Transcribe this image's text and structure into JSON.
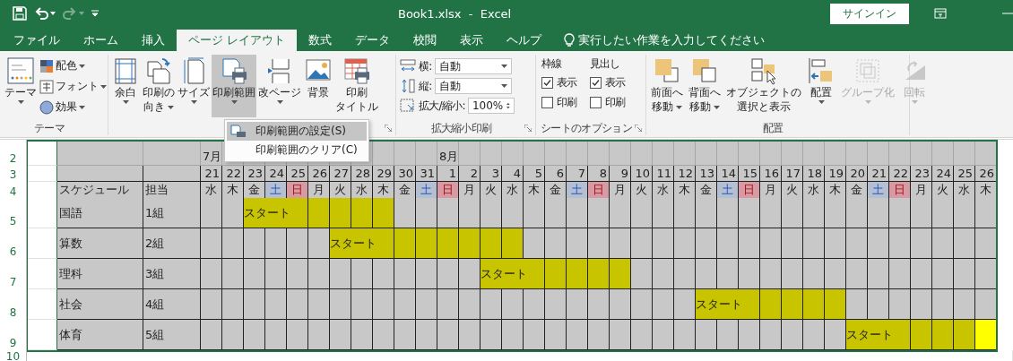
{
  "title_bar": {
    "title": "Book1.xlsx  -  Excel",
    "redo_disabled": true,
    "sign_in": "サインイン"
  },
  "tabs": [
    {
      "label": "ファイル",
      "selected": false
    },
    {
      "label": "ホーム",
      "selected": false
    },
    {
      "label": "挿入",
      "selected": false
    },
    {
      "label": "ページ レイアウト",
      "selected": true
    },
    {
      "label": "数式",
      "selected": false
    },
    {
      "label": "データ",
      "selected": false
    },
    {
      "label": "校閲",
      "selected": false
    },
    {
      "label": "表示",
      "selected": false
    },
    {
      "label": "ヘルプ",
      "selected": false
    }
  ],
  "tell_me": "実行したい作業を入力してください",
  "ribbon": {
    "theme": {
      "label": "テーマ",
      "button": {
        "lines": [
          "テーマ"
        ]
      },
      "options": [
        {
          "label": "配色"
        },
        {
          "label": "フォント"
        },
        {
          "label": "効果"
        }
      ]
    },
    "page_setup": {
      "buttons": [
        {
          "lines": [
            "余白"
          ],
          "has_menu": true,
          "pressed": false
        },
        {
          "lines": [
            "印刷の",
            "向き"
          ],
          "has_menu": true,
          "pressed": false
        },
        {
          "lines": [
            "サイズ"
          ],
          "has_menu": true,
          "pressed": false
        },
        {
          "lines": [
            "印刷範囲"
          ],
          "has_menu": true,
          "pressed": true
        },
        {
          "lines": [
            "改ページ"
          ],
          "has_menu": true,
          "pressed": false
        },
        {
          "lines": [
            "背景"
          ],
          "has_menu": false,
          "pressed": false
        },
        {
          "lines": [
            "印刷",
            "タイトル"
          ],
          "has_menu": false,
          "pressed": false
        }
      ]
    },
    "scale": {
      "label": "拡大縮小印刷",
      "fields": [
        {
          "label": "横:",
          "value": "自動",
          "kind": "dropdown"
        },
        {
          "label": "縦:",
          "value": "自動",
          "kind": "dropdown"
        },
        {
          "label": "拡大/縮小:",
          "value": "100%",
          "kind": "spinner"
        }
      ]
    },
    "sheet_options": {
      "label": "シートのオプション",
      "columns": [
        {
          "heading": "枠線",
          "options": [
            {
              "label": "表示",
              "checked": true
            },
            {
              "label": "印刷",
              "checked": false
            }
          ]
        },
        {
          "heading": "見出し",
          "options": [
            {
              "label": "表示",
              "checked": true
            },
            {
              "label": "印刷",
              "checked": false
            }
          ]
        }
      ]
    },
    "arrange": {
      "label": "配置",
      "buttons": [
        {
          "lines": [
            "前面へ",
            "移動"
          ],
          "has_menu": true,
          "disabled": false
        },
        {
          "lines": [
            "背面へ",
            "移動"
          ],
          "has_menu": true,
          "disabled": false
        },
        {
          "lines": [
            "オブジェクトの",
            "選択と表示"
          ],
          "has_menu": false,
          "disabled": false
        },
        {
          "lines": [
            "配置"
          ],
          "has_menu": true,
          "disabled": false
        },
        {
          "lines": [
            "グループ化"
          ],
          "has_menu": true,
          "disabled": true
        },
        {
          "lines": [
            "回転"
          ],
          "has_menu": true,
          "disabled": true
        }
      ]
    }
  },
  "print_area_menu": {
    "items": [
      {
        "label": "印刷範囲の設定(S)",
        "selected": true
      },
      {
        "label": "印刷範囲のクリア(C)",
        "selected": false
      }
    ]
  },
  "sheet": {
    "row_numbers": [
      "2",
      "3",
      "4",
      "5",
      "6",
      "7",
      "8",
      "9",
      "10"
    ],
    "headers": [
      "スケジュール",
      "担当"
    ],
    "days": [
      {
        "month": "7月",
        "date": "21",
        "weekday": "水",
        "kind": "weekday"
      },
      {
        "date": "22",
        "weekday": "木",
        "kind": "weekday"
      },
      {
        "date": "23",
        "weekday": "金",
        "kind": "weekday"
      },
      {
        "date": "24",
        "weekday": "土",
        "kind": "saturday"
      },
      {
        "date": "25",
        "weekday": "日",
        "kind": "sunday"
      },
      {
        "date": "26",
        "weekday": "月",
        "kind": "weekday"
      },
      {
        "date": "27",
        "weekday": "火",
        "kind": "weekday"
      },
      {
        "date": "28",
        "weekday": "水",
        "kind": "weekday"
      },
      {
        "date": "29",
        "weekday": "木",
        "kind": "weekday"
      },
      {
        "date": "30",
        "weekday": "金",
        "kind": "weekday"
      },
      {
        "date": "31",
        "weekday": "土",
        "kind": "saturday"
      },
      {
        "month": "8月",
        "date": "1",
        "weekday": "日",
        "kind": "sunday"
      },
      {
        "date": "2",
        "weekday": "月",
        "kind": "weekday"
      },
      {
        "date": "3",
        "weekday": "火",
        "kind": "weekday"
      },
      {
        "date": "4",
        "weekday": "水",
        "kind": "weekday"
      },
      {
        "date": "5",
        "weekday": "木",
        "kind": "weekday"
      },
      {
        "date": "6",
        "weekday": "金",
        "kind": "weekday"
      },
      {
        "date": "7",
        "weekday": "土",
        "kind": "saturday"
      },
      {
        "date": "8",
        "weekday": "日",
        "kind": "sunday"
      },
      {
        "date": "9",
        "weekday": "月",
        "kind": "weekday"
      },
      {
        "date": "10",
        "weekday": "火",
        "kind": "weekday"
      },
      {
        "date": "11",
        "weekday": "水",
        "kind": "weekday"
      },
      {
        "date": "12",
        "weekday": "木",
        "kind": "weekday"
      },
      {
        "date": "13",
        "weekday": "金",
        "kind": "weekday"
      },
      {
        "date": "14",
        "weekday": "土",
        "kind": "saturday"
      },
      {
        "date": "15",
        "weekday": "日",
        "kind": "sunday"
      },
      {
        "date": "16",
        "weekday": "月",
        "kind": "weekday"
      },
      {
        "date": "17",
        "weekday": "火",
        "kind": "weekday"
      },
      {
        "date": "18",
        "weekday": "水",
        "kind": "weekday"
      },
      {
        "date": "19",
        "weekday": "木",
        "kind": "weekday"
      },
      {
        "date": "20",
        "weekday": "金",
        "kind": "weekday"
      },
      {
        "date": "21",
        "weekday": "土",
        "kind": "saturday"
      },
      {
        "date": "22",
        "weekday": "日",
        "kind": "sunday"
      },
      {
        "date": "23",
        "weekday": "月",
        "kind": "weekday"
      },
      {
        "date": "24",
        "weekday": "火",
        "kind": "weekday"
      },
      {
        "date": "25",
        "weekday": "水",
        "kind": "weekday"
      },
      {
        "date": "26",
        "weekday": "木",
        "kind": "weekday"
      }
    ],
    "rows": [
      {
        "subject": "国語",
        "group": "1組",
        "cells": [
          {
            "filled": false,
            "highlighted": false
          },
          {
            "filled": false,
            "highlighted": false
          },
          {
            "filled": true,
            "highlighted": false,
            "text": "スタート"
          },
          {
            "filled": true,
            "highlighted": false
          },
          {
            "filled": true,
            "highlighted": false
          },
          {
            "filled": true,
            "highlighted": false
          },
          {
            "filled": true,
            "highlighted": false
          },
          {
            "filled": false,
            "highlighted": false
          },
          {
            "filled": false,
            "highlighted": false
          },
          {
            "filled": false,
            "highlighted": false
          },
          {
            "filled": false,
            "highlighted": false
          },
          {
            "filled": false,
            "highlighted": false
          },
          {
            "filled": false,
            "highlighted": false
          },
          {
            "filled": false,
            "highlighted": false
          },
          {
            "filled": false,
            "highlighted": false
          },
          {
            "filled": false,
            "highlighted": false
          },
          {
            "filled": false,
            "highlighted": false
          },
          {
            "filled": false,
            "highlighted": false
          },
          {
            "filled": false,
            "highlighted": false
          },
          {
            "filled": false,
            "highlighted": false
          },
          {
            "filled": false,
            "highlighted": false
          },
          {
            "filled": false,
            "highlighted": false
          },
          {
            "filled": false,
            "highlighted": false
          },
          {
            "filled": false,
            "highlighted": false
          },
          {
            "filled": false,
            "highlighted": false
          },
          {
            "filled": false,
            "highlighted": false
          },
          {
            "filled": false,
            "highlighted": false
          },
          {
            "filled": false,
            "highlighted": false
          },
          {
            "filled": false,
            "highlighted": false
          },
          {
            "filled": false,
            "highlighted": false
          },
          {
            "filled": false,
            "highlighted": false
          },
          {
            "filled": false,
            "highlighted": false
          },
          {
            "filled": false,
            "highlighted": false
          },
          {
            "filled": false,
            "highlighted": false
          },
          {
            "filled": false,
            "highlighted": false
          }
        ]
      },
      {
        "subject": "算数",
        "group": "2組",
        "cells": [
          {
            "filled": false,
            "highlighted": false
          },
          {
            "filled": false,
            "highlighted": false
          },
          {
            "filled": false,
            "highlighted": false
          },
          {
            "filled": false,
            "highlighted": false
          },
          {
            "filled": false,
            "highlighted": false
          },
          {
            "filled": false,
            "highlighted": false
          },
          {
            "filled": true,
            "highlighted": false,
            "text": "スタート"
          },
          {
            "filled": true,
            "highlighted": false
          },
          {
            "filled": true,
            "highlighted": false
          },
          {
            "filled": true,
            "highlighted": false
          },
          {
            "filled": true,
            "highlighted": false
          },
          {
            "filled": true,
            "highlighted": false
          },
          {
            "filled": true,
            "highlighted": false
          },
          {
            "filled": false,
            "highlighted": false
          },
          {
            "filled": false,
            "highlighted": false
          },
          {
            "filled": false,
            "highlighted": false
          },
          {
            "filled": false,
            "highlighted": false
          },
          {
            "filled": false,
            "highlighted": false
          },
          {
            "filled": false,
            "highlighted": false
          },
          {
            "filled": false,
            "highlighted": false
          },
          {
            "filled": false,
            "highlighted": false
          },
          {
            "filled": false,
            "highlighted": false
          },
          {
            "filled": false,
            "highlighted": false
          },
          {
            "filled": false,
            "highlighted": false
          },
          {
            "filled": false,
            "highlighted": false
          },
          {
            "filled": false,
            "highlighted": false
          },
          {
            "filled": false,
            "highlighted": false
          },
          {
            "filled": false,
            "highlighted": false
          },
          {
            "filled": false,
            "highlighted": false
          },
          {
            "filled": false,
            "highlighted": false
          },
          {
            "filled": false,
            "highlighted": false
          },
          {
            "filled": false,
            "highlighted": false
          },
          {
            "filled": false,
            "highlighted": false
          },
          {
            "filled": false,
            "highlighted": false
          },
          {
            "filled": false,
            "highlighted": false
          }
        ]
      },
      {
        "subject": "理科",
        "group": "3組",
        "cells": [
          {
            "filled": false,
            "highlighted": false
          },
          {
            "filled": false,
            "highlighted": false
          },
          {
            "filled": false,
            "highlighted": false
          },
          {
            "filled": false,
            "highlighted": false
          },
          {
            "filled": false,
            "highlighted": false
          },
          {
            "filled": false,
            "highlighted": false
          },
          {
            "filled": false,
            "highlighted": false
          },
          {
            "filled": false,
            "highlighted": false
          },
          {
            "filled": false,
            "highlighted": false
          },
          {
            "filled": false,
            "highlighted": false
          },
          {
            "filled": false,
            "highlighted": false
          },
          {
            "filled": false,
            "highlighted": false
          },
          {
            "filled": false,
            "highlighted": false
          },
          {
            "filled": true,
            "highlighted": false,
            "text": "スタート"
          },
          {
            "filled": true,
            "highlighted": false
          },
          {
            "filled": true,
            "highlighted": false
          },
          {
            "filled": true,
            "highlighted": false
          },
          {
            "filled": true,
            "highlighted": false
          },
          {
            "filled": false,
            "highlighted": false
          },
          {
            "filled": false,
            "highlighted": false
          },
          {
            "filled": false,
            "highlighted": false
          },
          {
            "filled": false,
            "highlighted": false
          },
          {
            "filled": false,
            "highlighted": false
          },
          {
            "filled": false,
            "highlighted": false
          },
          {
            "filled": false,
            "highlighted": false
          },
          {
            "filled": false,
            "highlighted": false
          },
          {
            "filled": false,
            "highlighted": false
          },
          {
            "filled": false,
            "highlighted": false
          },
          {
            "filled": false,
            "highlighted": false
          },
          {
            "filled": false,
            "highlighted": false
          },
          {
            "filled": false,
            "highlighted": false
          },
          {
            "filled": false,
            "highlighted": false
          },
          {
            "filled": false,
            "highlighted": false
          },
          {
            "filled": false,
            "highlighted": false
          },
          {
            "filled": false,
            "highlighted": false
          }
        ]
      },
      {
        "subject": "社会",
        "group": "4組",
        "cells": [
          {
            "filled": false,
            "highlighted": false
          },
          {
            "filled": false,
            "highlighted": false
          },
          {
            "filled": false,
            "highlighted": false
          },
          {
            "filled": false,
            "highlighted": false
          },
          {
            "filled": false,
            "highlighted": false
          },
          {
            "filled": false,
            "highlighted": false
          },
          {
            "filled": false,
            "highlighted": false
          },
          {
            "filled": false,
            "highlighted": false
          },
          {
            "filled": false,
            "highlighted": false
          },
          {
            "filled": false,
            "highlighted": false
          },
          {
            "filled": false,
            "highlighted": false
          },
          {
            "filled": false,
            "highlighted": false
          },
          {
            "filled": false,
            "highlighted": false
          },
          {
            "filled": false,
            "highlighted": false
          },
          {
            "filled": false,
            "highlighted": false
          },
          {
            "filled": false,
            "highlighted": false
          },
          {
            "filled": false,
            "highlighted": false
          },
          {
            "filled": false,
            "highlighted": false
          },
          {
            "filled": false,
            "highlighted": false
          },
          {
            "filled": false,
            "highlighted": false
          },
          {
            "filled": false,
            "highlighted": false
          },
          {
            "filled": false,
            "highlighted": false
          },
          {
            "filled": false,
            "highlighted": false
          },
          {
            "filled": true,
            "highlighted": false,
            "text": "スタート"
          },
          {
            "filled": true,
            "highlighted": false
          },
          {
            "filled": true,
            "highlighted": false
          },
          {
            "filled": true,
            "highlighted": false
          },
          {
            "filled": true,
            "highlighted": false
          },
          {
            "filled": false,
            "highlighted": false
          },
          {
            "filled": false,
            "highlighted": false
          },
          {
            "filled": false,
            "highlighted": false
          },
          {
            "filled": false,
            "highlighted": false
          },
          {
            "filled": false,
            "highlighted": false
          },
          {
            "filled": false,
            "highlighted": false
          },
          {
            "filled": false,
            "highlighted": false
          }
        ]
      },
      {
        "subject": "体育",
        "group": "5組",
        "cells": [
          {
            "filled": false,
            "highlighted": false
          },
          {
            "filled": false,
            "highlighted": false
          },
          {
            "filled": false,
            "highlighted": false
          },
          {
            "filled": false,
            "highlighted": false
          },
          {
            "filled": false,
            "highlighted": false
          },
          {
            "filled": false,
            "highlighted": false
          },
          {
            "filled": false,
            "highlighted": false
          },
          {
            "filled": false,
            "highlighted": false
          },
          {
            "filled": false,
            "highlighted": false
          },
          {
            "filled": false,
            "highlighted": false
          },
          {
            "filled": false,
            "highlighted": false
          },
          {
            "filled": false,
            "highlighted": false
          },
          {
            "filled": false,
            "highlighted": false
          },
          {
            "filled": false,
            "highlighted": false
          },
          {
            "filled": false,
            "highlighted": false
          },
          {
            "filled": false,
            "highlighted": false
          },
          {
            "filled": false,
            "highlighted": false
          },
          {
            "filled": false,
            "highlighted": false
          },
          {
            "filled": false,
            "highlighted": false
          },
          {
            "filled": false,
            "highlighted": false
          },
          {
            "filled": false,
            "highlighted": false
          },
          {
            "filled": false,
            "highlighted": false
          },
          {
            "filled": false,
            "highlighted": false
          },
          {
            "filled": false,
            "highlighted": false
          },
          {
            "filled": false,
            "highlighted": false
          },
          {
            "filled": false,
            "highlighted": false
          },
          {
            "filled": false,
            "highlighted": false
          },
          {
            "filled": false,
            "highlighted": false
          },
          {
            "filled": false,
            "highlighted": false
          },
          {
            "filled": false,
            "highlighted": false
          },
          {
            "filled": true,
            "highlighted": false,
            "text": "スタート"
          },
          {
            "filled": true,
            "highlighted": false
          },
          {
            "filled": true,
            "highlighted": false
          },
          {
            "filled": true,
            "highlighted": false
          },
          {
            "filled": true,
            "highlighted": true
          }
        ]
      }
    ]
  }
}
